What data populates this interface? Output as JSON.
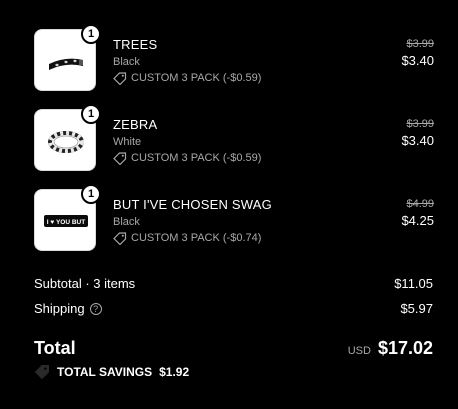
{
  "cart": {
    "items": [
      {
        "name": "TREES",
        "variant": "Black",
        "quantity": "1",
        "discount": "CUSTOM 3 PACK (-$0.59)",
        "original_price": "$3.99",
        "price": "$3.40",
        "thumbnail_icon": "black-bracelet-studs"
      },
      {
        "name": "ZEBRA",
        "variant": "White",
        "quantity": "1",
        "discount": "CUSTOM 3 PACK (-$0.59)",
        "original_price": "$3.99",
        "price": "$3.40",
        "thumbnail_icon": "zebra-bracelet"
      },
      {
        "name": "BUT I'VE CHOSEN SWAG",
        "variant": "Black",
        "quantity": "1",
        "discount": "CUSTOM 3 PACK (-$0.74)",
        "original_price": "$4.99",
        "price": "$4.25",
        "thumbnail_icon": "i-love-you-but-bracelet",
        "thumbnail_text": "I ♥ YOU BUT"
      }
    ]
  },
  "summary": {
    "subtotal_label": "Subtotal · 3 items",
    "subtotal_value": "$11.05",
    "shipping_label": "Shipping",
    "shipping_help": "?",
    "shipping_value": "$5.97",
    "total_label": "Total",
    "currency": "USD",
    "total_value": "$17.02",
    "savings_label": "TOTAL SAVINGS",
    "savings_value": "$1.92"
  },
  "colors": {
    "background": "#000000",
    "text_primary": "#ffffff",
    "text_secondary": "#a8a8a8"
  }
}
